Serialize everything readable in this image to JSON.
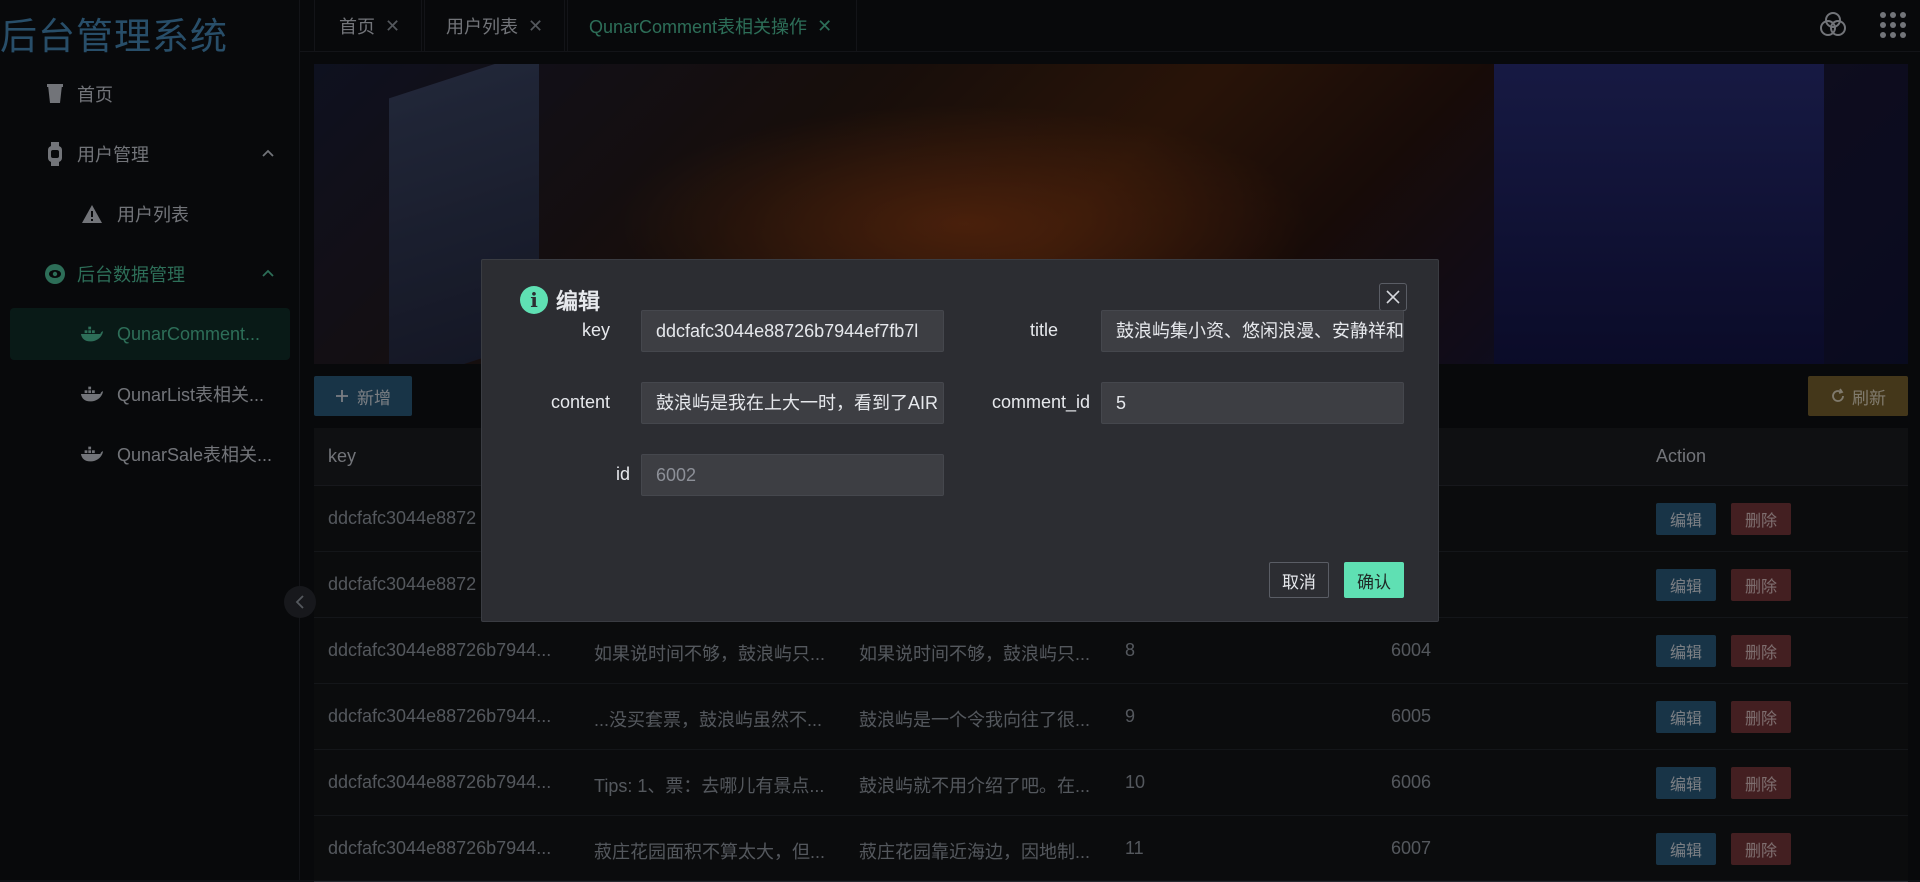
{
  "app": {
    "title": "后台管理系统"
  },
  "sidebar": {
    "items": [
      {
        "label": "首页"
      },
      {
        "label": "用户管理"
      },
      {
        "label": "用户列表"
      },
      {
        "label": "后台数据管理"
      },
      {
        "label": "QunarComment..."
      },
      {
        "label": "QunarList表相关..."
      },
      {
        "label": "QunarSale表相关..."
      }
    ]
  },
  "tabs": [
    {
      "label": "首页",
      "close": "✕"
    },
    {
      "label": "用户列表",
      "close": "✕"
    },
    {
      "label": "QunarComment表相关操作",
      "close": "✕"
    }
  ],
  "toolbar": {
    "add_label": "新增",
    "refresh_label": "刷新"
  },
  "table": {
    "headers": {
      "key": "key",
      "action": "Action"
    },
    "edit_label": "编辑",
    "delete_label": "删除",
    "rows": [
      {
        "key": "ddcfafc3044e8872",
        "title": "",
        "content": "",
        "comment_id": "",
        "id": ""
      },
      {
        "key": "ddcfafc3044e8872",
        "title": "",
        "content": "",
        "comment_id": "",
        "id": ""
      },
      {
        "key": "ddcfafc3044e88726b7944...",
        "title": "如果说时间不够，鼓浪屿只...",
        "content": "如果说时间不够，鼓浪屿只...",
        "comment_id": "8",
        "id": "6004"
      },
      {
        "key": "ddcfafc3044e88726b7944...",
        "title": "...没买套票，鼓浪屿虽然不...",
        "content": "鼓浪屿是一个令我向往了很...",
        "comment_id": "9",
        "id": "6005"
      },
      {
        "key": "ddcfafc3044e88726b7944...",
        "title": "Tips: 1、票：去哪儿有景点...",
        "content": "鼓浪屿就不用介绍了吧。在...",
        "comment_id": "10",
        "id": "6006"
      },
      {
        "key": "ddcfafc3044e88726b7944...",
        "title": "菽庄花园面积不算太大，但...",
        "content": "菽庄花园靠近海边，因地制...",
        "comment_id": "11",
        "id": "6007"
      }
    ]
  },
  "modal": {
    "title": "编辑",
    "info_glyph": "i",
    "fields": {
      "key_label": "key",
      "key_value": "ddcfafc3044e88726b7944ef7fb7l",
      "title_label": "title",
      "title_value": "鼓浪屿集小资、悠闲浪漫、安静祥和",
      "content_label": "content",
      "content_value": "鼓浪屿是我在上大一时，看到了AIR",
      "comment_id_label": "comment_id",
      "comment_id_value": "5",
      "id_label": "id",
      "id_placeholder": "6002"
    },
    "cancel_label": "取消",
    "ok_label": "确认"
  }
}
